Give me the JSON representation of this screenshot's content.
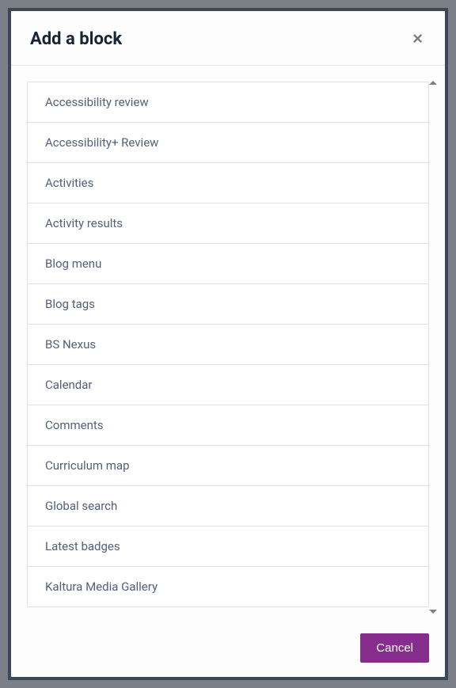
{
  "modal": {
    "title": "Add a block",
    "cancel_label": "Cancel"
  },
  "blocks": [
    {
      "label": "Accessibility review"
    },
    {
      "label": "Accessibility+ Review"
    },
    {
      "label": "Activities"
    },
    {
      "label": "Activity results"
    },
    {
      "label": "Blog menu"
    },
    {
      "label": "Blog tags"
    },
    {
      "label": "BS Nexus"
    },
    {
      "label": "Calendar"
    },
    {
      "label": "Comments"
    },
    {
      "label": "Curriculum map"
    },
    {
      "label": "Global search"
    },
    {
      "label": "Latest badges"
    },
    {
      "label": "Kaltura Media Gallery"
    }
  ]
}
